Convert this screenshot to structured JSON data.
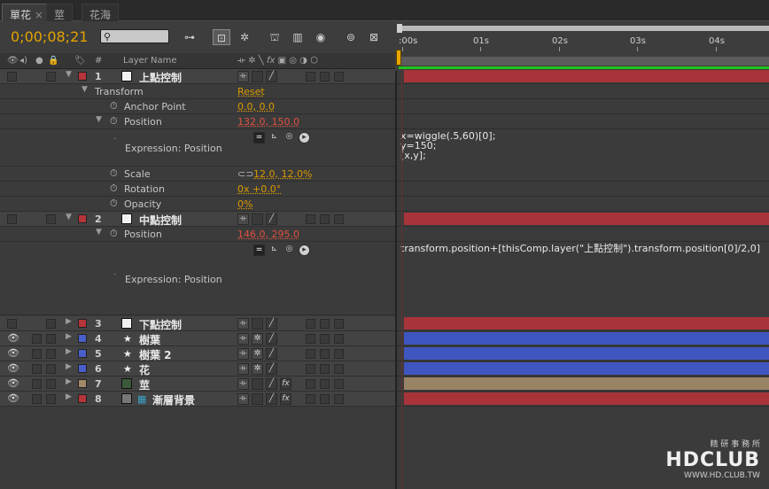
{
  "tabs": [
    "單花",
    "莖",
    "花海"
  ],
  "toolbar": {
    "timecode": "0;00;08;21",
    "search_value": ""
  },
  "timeline": {
    "ticks": [
      ":00s",
      "01s",
      "02s",
      "03s",
      "04s"
    ]
  },
  "columns": {
    "num": "#",
    "layer_name": "Layer Name"
  },
  "layers": [
    {
      "num": "1",
      "name": "上點控制",
      "label_color": "#b5353a",
      "bar_color": "#a8343a"
    },
    {
      "num": "2",
      "name": "中點控制",
      "label_color": "#b5353a",
      "bar_color": "#a8343a"
    },
    {
      "num": "3",
      "name": "下點控制",
      "label_color": "#b5353a",
      "bar_color": "#a8343a"
    },
    {
      "num": "4",
      "name": "樹葉",
      "label_color": "#4a5fc9",
      "bar_color": "#3f55c0"
    },
    {
      "num": "5",
      "name": "樹葉 2",
      "label_color": "#4a5fc9",
      "bar_color": "#3f55c0"
    },
    {
      "num": "6",
      "name": "花",
      "label_color": "#4a5fc9",
      "bar_color": "#3f55c0"
    },
    {
      "num": "7",
      "name": "莖",
      "label_color": "#a08a68",
      "bar_color": "#9a8466"
    },
    {
      "num": "8",
      "name": "漸層背景",
      "label_color": "#b5353a",
      "bar_color": "#a8343a"
    }
  ],
  "layer1": {
    "transform_label": "Transform",
    "reset_label": "Reset",
    "anchor_label": "Anchor Point",
    "anchor_value": "0.0, 0.0",
    "position_label": "Position",
    "position_value": "132.0, 150.0",
    "expression_label": "Expression: Position",
    "expression": [
      "x=wiggle(.5,60)[0];",
      "y=150;",
      "[x,y];"
    ],
    "scale_label": "Scale",
    "scale_value": "12.0, 12.0%",
    "rotation_label": "Rotation",
    "rotation_value": "0x +0.0°",
    "opacity_label": "Opacity",
    "opacity_value": "0%"
  },
  "layer2": {
    "position_label": "Position",
    "position_value": "146.0, 295.0",
    "expression_label": "Expression: Position",
    "expression": "transform.position+[thisComp.layer(\"上點控制\").transform.position[0]/2,0]"
  },
  "watermark": {
    "brand": "HDCLUB",
    "tagline": "精 研 事 務 所",
    "url": "WWW.HD.CLUB.TW"
  }
}
